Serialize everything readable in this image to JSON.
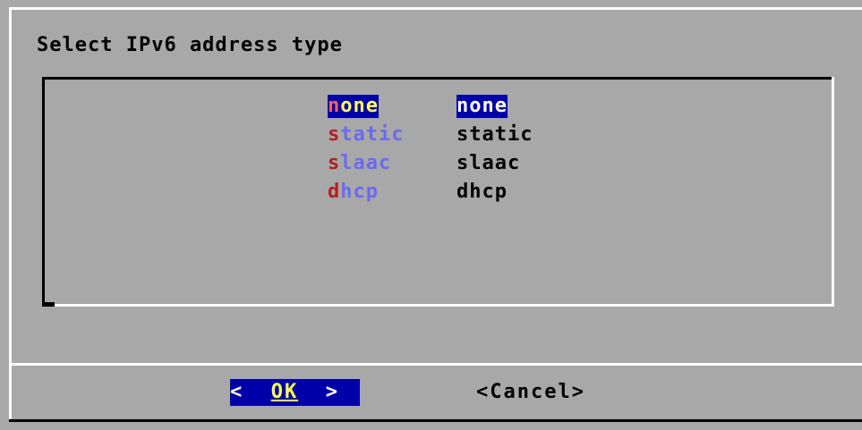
{
  "dialog": {
    "title": "Select IPv6 address type"
  },
  "list": {
    "items": [
      {
        "tag_hot": "n",
        "tag_rest": "one",
        "desc": "none",
        "selected": true
      },
      {
        "tag_hot": "s",
        "tag_rest": "tatic",
        "desc": "static",
        "selected": false
      },
      {
        "tag_hot": "s",
        "tag_rest": "laac",
        "desc": "slaac",
        "selected": false
      },
      {
        "tag_hot": "d",
        "tag_rest": "hcp",
        "desc": "dhcp",
        "selected": false
      }
    ]
  },
  "buttons": {
    "ok_left": "<",
    "ok_label": "OK",
    "ok_right": ">",
    "cancel": "<Cancel>"
  },
  "colors": {
    "dialog_bg": "#a8a8a8",
    "selection_bg": "#0000a8",
    "hotkey": "#b02020",
    "tag_text": "#6a6af0",
    "highlight_text": "#ffff55"
  }
}
